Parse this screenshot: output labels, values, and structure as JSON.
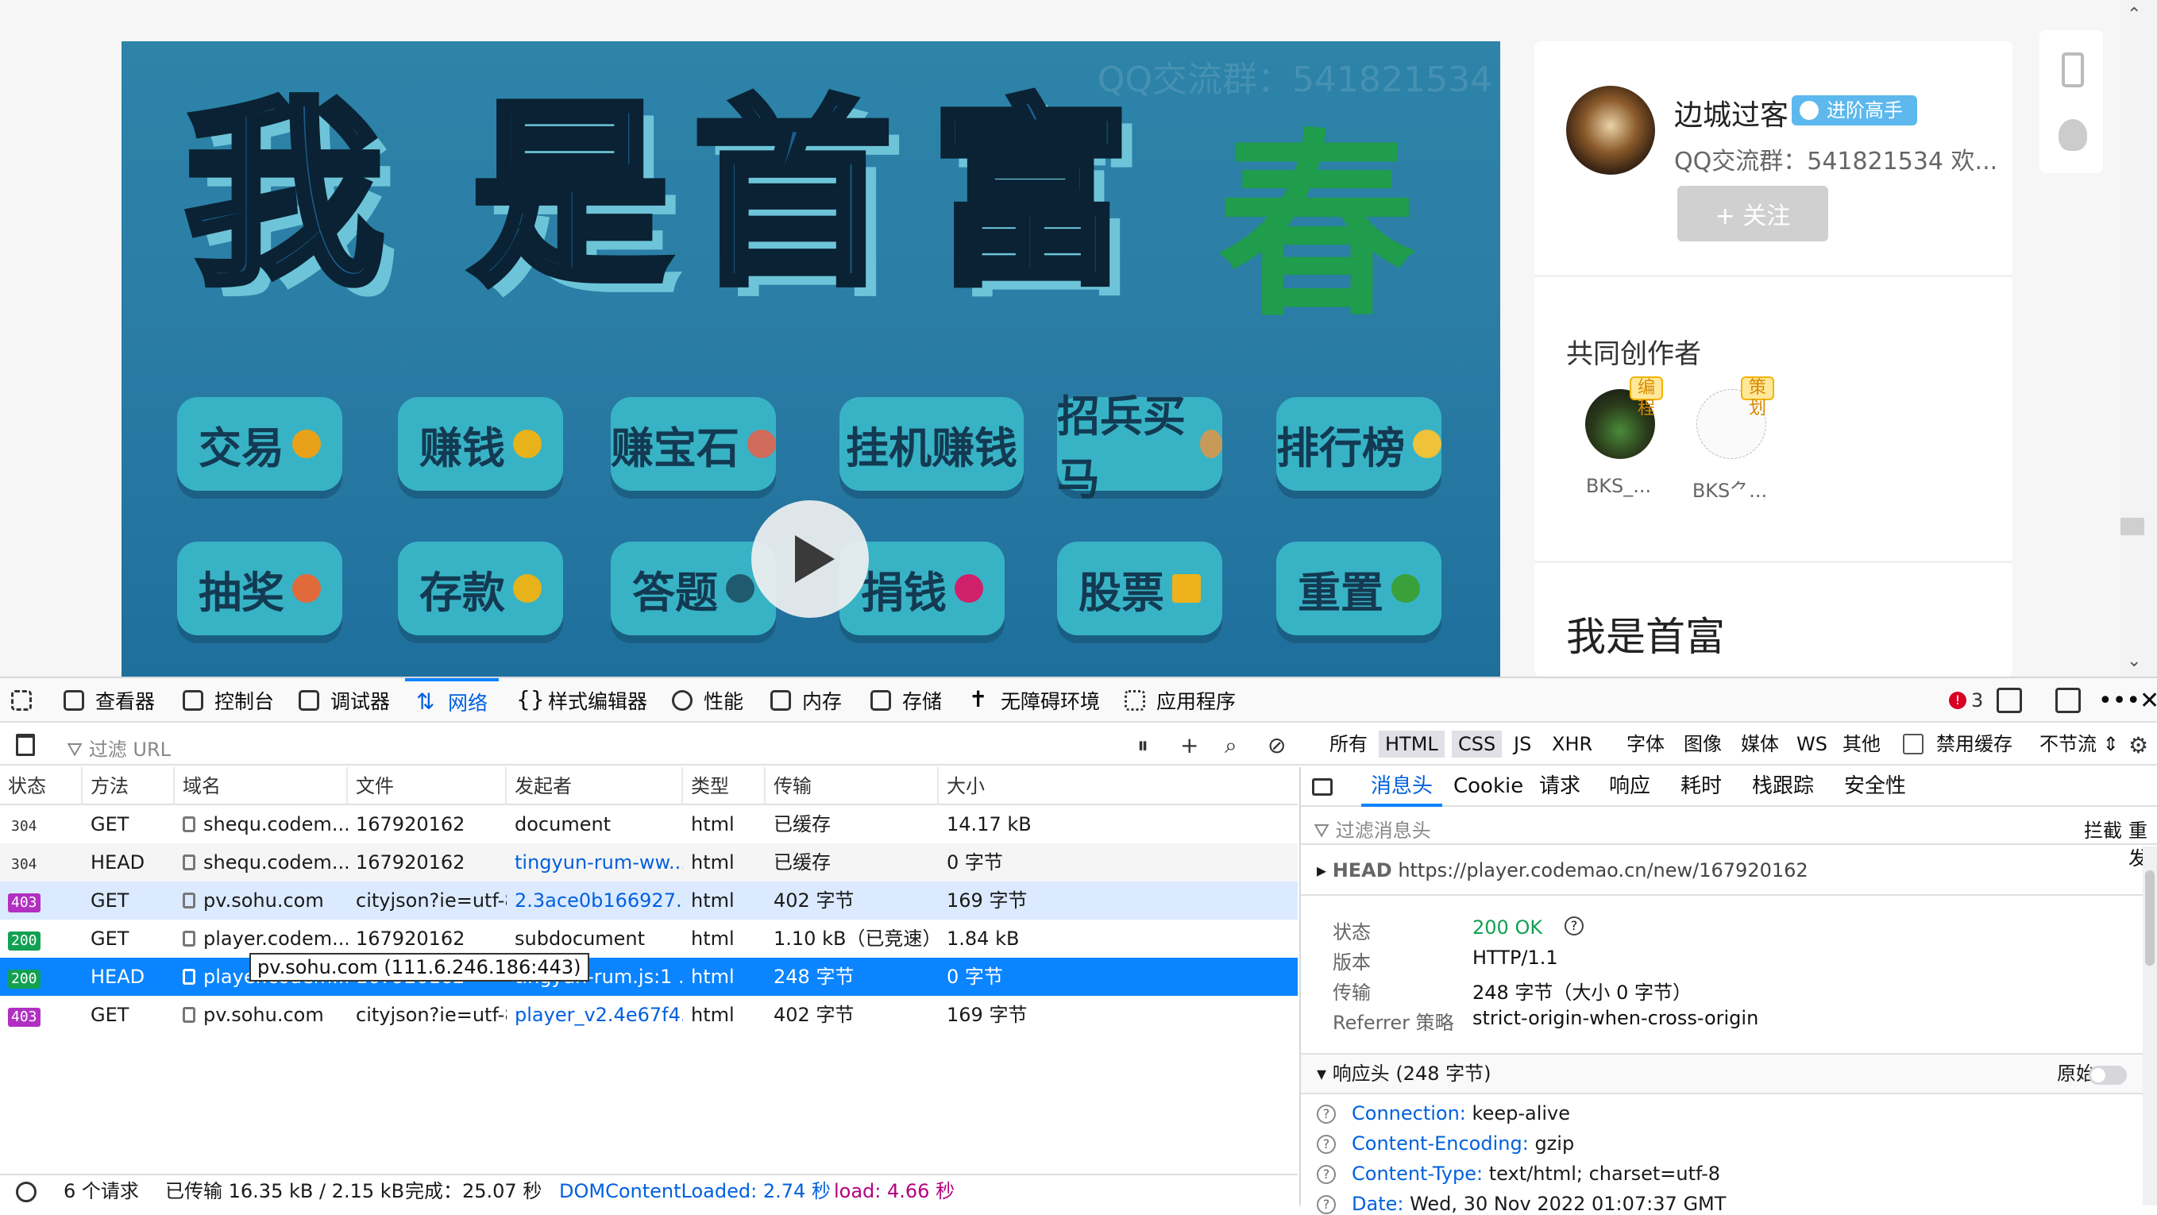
{
  "video": {
    "title_chars": [
      "我",
      "是",
      "首",
      "富",
      "春"
    ],
    "watermark": "QQ交流群：541821534",
    "buttons_row1": [
      "交易",
      "赚钱",
      "赚宝石",
      "挂机赚钱",
      "招兵买马",
      "排行榜"
    ],
    "buttons_row2": [
      "抽奖",
      "存款",
      "答题",
      "捐钱",
      "股票",
      "重置"
    ]
  },
  "author": {
    "name": "边城过客",
    "badge": "进阶高手",
    "desc": "QQ交流群：541821534 欢...",
    "follow": "+ 关注"
  },
  "coauthors": {
    "title": "共同创作者",
    "list": [
      {
        "tag": "编程",
        "name": "BKS_..."
      },
      {
        "tag": "策划",
        "name": "BKS⺈..."
      }
    ]
  },
  "work_title": "我是首富",
  "devtools": {
    "tools": [
      "查看器",
      "控制台",
      "调试器",
      "网络",
      "样式编辑器",
      "性能",
      "内存",
      "存储",
      "无障碍环境",
      "应用程序"
    ],
    "error_count": "3",
    "filter_placeholder": "过滤 URL",
    "type_filters": [
      "所有",
      "HTML",
      "CSS",
      "JS",
      "XHR",
      "字体",
      "图像",
      "媒体",
      "WS",
      "其他"
    ],
    "disable_cache": "禁用缓存",
    "throttle": "不节流 ⇕",
    "columns": [
      "状态",
      "方法",
      "域名",
      "文件",
      "发起者",
      "类型",
      "传输",
      "大小"
    ],
    "rows": [
      {
        "status": "304",
        "method": "GET",
        "domain": "shequ.codem...",
        "file": "167920162",
        "initiator": "document",
        "type": "html",
        "transfer": "已缓存",
        "size": "14.17 kB"
      },
      {
        "status": "304",
        "method": "HEAD",
        "domain": "shequ.codem...",
        "file": "167920162",
        "initiator": "tingyun-rum-ww...",
        "type": "html",
        "transfer": "已缓存",
        "size": "0 字节"
      },
      {
        "status": "403",
        "method": "GET",
        "domain": "pv.sohu.com",
        "file": "cityjson?ie=utf-8",
        "initiator": "2.3ace0b166927...",
        "type": "html",
        "transfer": "402 字节",
        "size": "169 字节"
      },
      {
        "status": "200",
        "method": "GET",
        "domain": "player.codem...",
        "file": "167920162",
        "initiator": "subdocument",
        "type": "html",
        "transfer": "1.10 kB（已竞速）",
        "size": "1.84 kB"
      },
      {
        "status": "200",
        "method": "HEAD",
        "domain": "player.codem...",
        "file": "167920162",
        "initiator": "tingyun-rum.js:1 ...",
        "type": "html",
        "transfer": "248 字节",
        "size": "0 字节"
      },
      {
        "status": "403",
        "method": "GET",
        "domain": "pv.sohu.com",
        "file": "cityjson?ie=utf-8",
        "initiator": "player_v2.4e67f4...",
        "type": "html",
        "transfer": "402 字节",
        "size": "169 字节"
      }
    ],
    "tooltip": "pv.sohu.com (111.6.246.186:443)",
    "statusbar": {
      "requests": "6 个请求",
      "transferred": "已传输 16.35 kB / 2.15 kB",
      "finish": "完成：25.07 秒",
      "dcl": "DOMContentLoaded: 2.74 秒",
      "load": "load: 4.66 秒"
    },
    "detail_tabs": [
      "消息头",
      "Cookie",
      "请求",
      "响应",
      "耗时",
      "栈跟踪",
      "安全性"
    ],
    "header_filter": "过滤消息头",
    "block": "拦截",
    "resend": "重发",
    "request_line": {
      "method": "HEAD",
      "url": "https://player.codemao.cn/new/167920162"
    },
    "summary": [
      {
        "k": "状态",
        "v": "200 OK"
      },
      {
        "k": "版本",
        "v": "HTTP/1.1"
      },
      {
        "k": "传输",
        "v": "248 字节（大小 0 字节）"
      },
      {
        "k": "Referrer 策略",
        "v": "strict-origin-when-cross-origin"
      }
    ],
    "response_section": "响应头 (248 字节)",
    "raw_label": "原始",
    "response_headers": [
      {
        "name": "Connection:",
        "value": "keep-alive"
      },
      {
        "name": "Content-Encoding:",
        "value": "gzip"
      },
      {
        "name": "Content-Type:",
        "value": "text/html; charset=utf-8"
      },
      {
        "name": "Date:",
        "value": "Wed, 30 Nov 2022 01:07:37 GMT"
      }
    ]
  }
}
